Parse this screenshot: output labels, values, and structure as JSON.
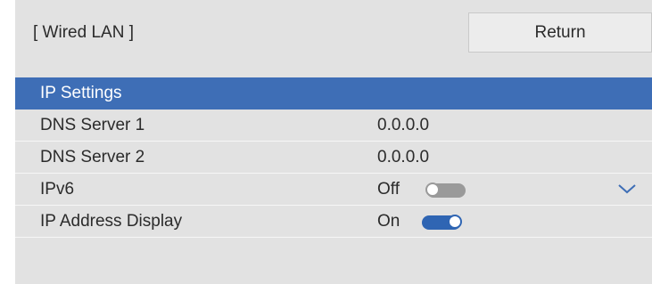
{
  "header": {
    "title": "[ Wired LAN ]",
    "return_label": "Return"
  },
  "rows": [
    {
      "label": "IP Settings"
    },
    {
      "label": "DNS Server 1",
      "value": "0.0.0.0"
    },
    {
      "label": "DNS Server 2",
      "value": "0.0.0.0"
    },
    {
      "label": "IPv6",
      "value": "Off",
      "toggle_on": false
    },
    {
      "label": "IP Address Display",
      "value": "On",
      "toggle_on": true
    }
  ],
  "colors": {
    "selected": "#3e6eb6",
    "toggle_on": "#2f65b3",
    "toggle_off": "#9a9a9a",
    "panel": "#e2e2e2"
  },
  "icons": {
    "scroll_down": "chevron-down-icon"
  }
}
